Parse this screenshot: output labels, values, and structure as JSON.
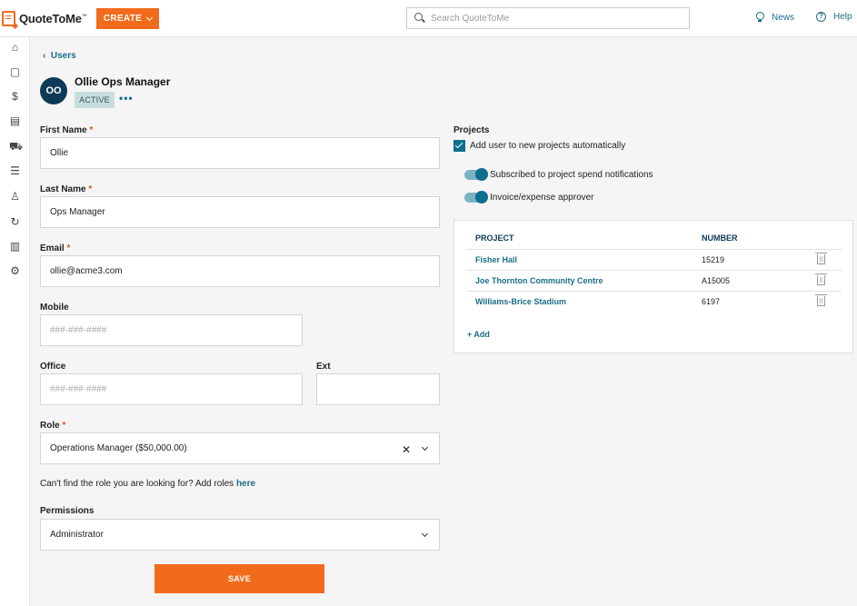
{
  "app": {
    "name": "QuoteToMe",
    "trademark": "™",
    "create_label": "CREATE"
  },
  "search": {
    "placeholder": "Search QuoteToMe"
  },
  "top_links": {
    "news": "News",
    "help": "Help"
  },
  "left_nav": [
    "home-icon",
    "clipboard-icon",
    "dollar-icon",
    "document-icon",
    "cart-icon",
    "list-icon",
    "person-icon",
    "refresh-icon",
    "store-icon",
    "gear-icon"
  ],
  "breadcrumb": {
    "back_label": "Users"
  },
  "user": {
    "initials": "OO",
    "name": "Ollie Ops Manager",
    "status": "ACTIVE"
  },
  "form": {
    "first_name": {
      "label": "First Name",
      "value": "Ollie"
    },
    "last_name": {
      "label": "Last Name",
      "value": "Ops Manager"
    },
    "email": {
      "label": "Email",
      "value": "ollie@acme3.com"
    },
    "mobile": {
      "label": "Mobile",
      "placeholder": "###-###-####"
    },
    "office": {
      "label": "Office",
      "placeholder": "###-###-####"
    },
    "ext": {
      "label": "Ext",
      "value": ""
    },
    "role": {
      "label": "Role",
      "value": "Operations Manager ($50,000.00)"
    },
    "role_hint": "Can't find the role you are looking for? Add roles",
    "role_hint_link": "here",
    "permissions": {
      "label": "Permissions",
      "value": "Administrator"
    },
    "required_mark": "*",
    "save_label": "SAVE"
  },
  "projects": {
    "title": "Projects",
    "auto_add_label": "Add user to new projects automatically",
    "auto_add_checked": true,
    "spend_notifications_label": "Subscribed to project spend notifications",
    "spend_notifications_on": true,
    "approver_label": "Invoice/expense approver",
    "approver_on": true,
    "table": {
      "headers": {
        "project": "PROJECT",
        "number": "NUMBER"
      },
      "rows": [
        {
          "project": "Fisher Hall",
          "number": "15219"
        },
        {
          "project": "Joe Thornton Community Centre",
          "number": "A15005"
        },
        {
          "project": "Williams-Brice Stadium",
          "number": "6197"
        }
      ]
    },
    "add_label": "+ Add"
  },
  "colors": {
    "brand": "#f26b1d",
    "accent": "#1a6e8a",
    "navy": "#0d3a56"
  }
}
